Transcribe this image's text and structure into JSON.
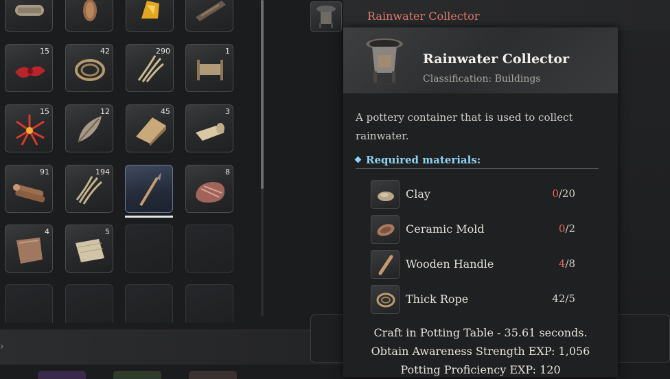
{
  "header": {
    "title": "Rainwater Collector"
  },
  "inventory": {
    "slots": [
      {
        "icon": "cloth-roll-icon",
        "count": ""
      },
      {
        "icon": "pinecone-icon",
        "count": ""
      },
      {
        "icon": "amber-icon",
        "count": ""
      },
      {
        "icon": "bark-icon",
        "count": ""
      },
      {
        "icon": "red-flower-icon",
        "count": "15"
      },
      {
        "icon": "rope-coil-icon",
        "count": "42"
      },
      {
        "icon": "plant-fiber-icon",
        "count": "290"
      },
      {
        "icon": "wooden-fence-icon",
        "count": "1"
      },
      {
        "icon": "red-spiky-flower-icon",
        "count": "15"
      },
      {
        "icon": "feather-leaf-icon",
        "count": "12"
      },
      {
        "icon": "wood-plank-icon",
        "count": "45"
      },
      {
        "icon": "paper-scroll-icon",
        "count": "3"
      },
      {
        "icon": "logs-icon",
        "count": "91"
      },
      {
        "icon": "fiber-bundle-icon",
        "count": "194"
      },
      {
        "icon": "spear-icon",
        "count": ""
      },
      {
        "icon": "raw-meat-icon",
        "count": "8"
      },
      {
        "icon": "leather-hide-icon",
        "count": "4"
      },
      {
        "icon": "cloth-sheet-icon",
        "count": "5"
      }
    ]
  },
  "tooltip": {
    "name": "Rainwater Collector",
    "classification": "Classification: Buildings",
    "description": "A pottery container that is used to collect rainwater.",
    "required_header": "Required materials:",
    "materials": [
      {
        "name": "Clay",
        "have": "0",
        "need": "/20",
        "icon": "clay-icon"
      },
      {
        "name": "Ceramic Mold",
        "have": "0",
        "need": "/2",
        "icon": "ceramic-mold-icon"
      },
      {
        "name": "Wooden Handle",
        "have": "4",
        "need": "/8",
        "icon": "wooden-handle-icon"
      },
      {
        "name": "Thick Rope",
        "have": "42",
        "need": "/5",
        "icon": "thick-rope-icon"
      }
    ],
    "craft_info": "Craft in Potting Table - 35.61 seconds.",
    "exp_awareness": "Obtain Awareness Strength EXP: 1,056",
    "exp_potting": "Potting Proficiency EXP: 120"
  },
  "colors": {
    "accent_title": "#e07a6a",
    "required": "#8fd3f0",
    "insufficient": "#e86a5a"
  }
}
